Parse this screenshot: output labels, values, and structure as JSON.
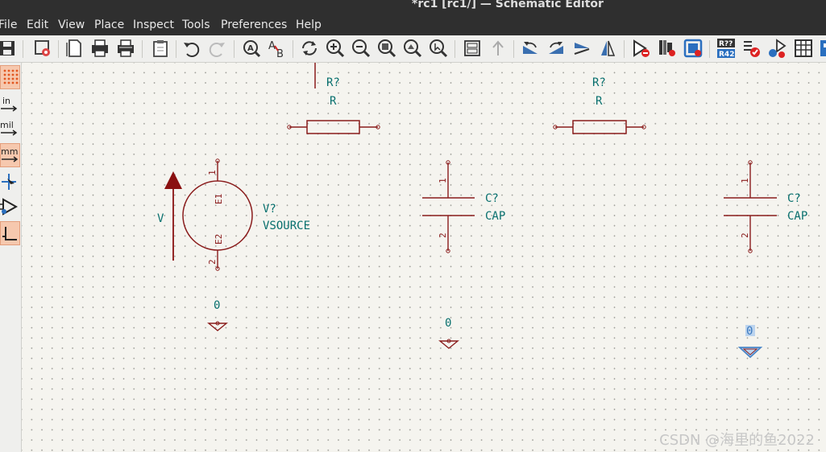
{
  "window": {
    "title": "*rc1 [rc1/] — Schematic Editor"
  },
  "menu": [
    "File",
    "Edit",
    "View",
    "Place",
    "Inspect",
    "Tools",
    "Preferences",
    "Help"
  ],
  "toolbar": {
    "icons": [
      "save-icon",
      "schematic-setup-icon",
      "page-settings-icon",
      "print-icon",
      "plot-icon",
      "paste-icon",
      "undo-icon",
      "redo-icon",
      "find-icon",
      "find-replace-icon",
      "refresh-icon",
      "zoom-in-icon",
      "zoom-out-icon",
      "zoom-fit-icon",
      "zoom-objects-icon",
      "zoom-selection-icon",
      "hierarchy-navigator-icon",
      "leave-sheet-icon",
      "rotate-ccw-icon",
      "rotate-cw-icon",
      "mirror-vertical-icon",
      "mirror-horizontal-icon",
      "symbol-editor-icon",
      "symbol-browser-icon",
      "footprint-assign-icon",
      "annotate-icon",
      "erc-icon",
      "simulator-icon",
      "bom-icon",
      "pcb-editor-icon"
    ],
    "annotate_badge_top": "R??",
    "annotate_badge_bottom": "R42"
  },
  "left_toolbar": {
    "inches_label": "in",
    "mils_label": "mil",
    "mm_label": "mm"
  },
  "schematic": {
    "resistor1": {
      "reference": "R?",
      "value": "R"
    },
    "resistor2": {
      "reference": "R?",
      "value": "R"
    },
    "vsource": {
      "reference": "V?",
      "value": "VSOURCE",
      "arrow_label": "V",
      "pin1_number": "1",
      "pin1_name": "E1",
      "pin2_number": "2",
      "pin2_name": "E2"
    },
    "cap1": {
      "reference": "C?",
      "value": "CAP",
      "pin1": "1",
      "pin2": "2"
    },
    "cap2": {
      "reference": "C?",
      "value": "CAP",
      "pin1": "1",
      "pin2": "2"
    },
    "ground1": {
      "label": "0"
    },
    "ground2": {
      "label": "0"
    },
    "ground3": {
      "label": "0"
    }
  },
  "watermark": "CSDN @海里的鱼2022",
  "colors": {
    "wire": "#8a1c1c",
    "text": "#08706e",
    "selected": "#4a86c8",
    "ground_triangle": "#8a1c1c"
  }
}
